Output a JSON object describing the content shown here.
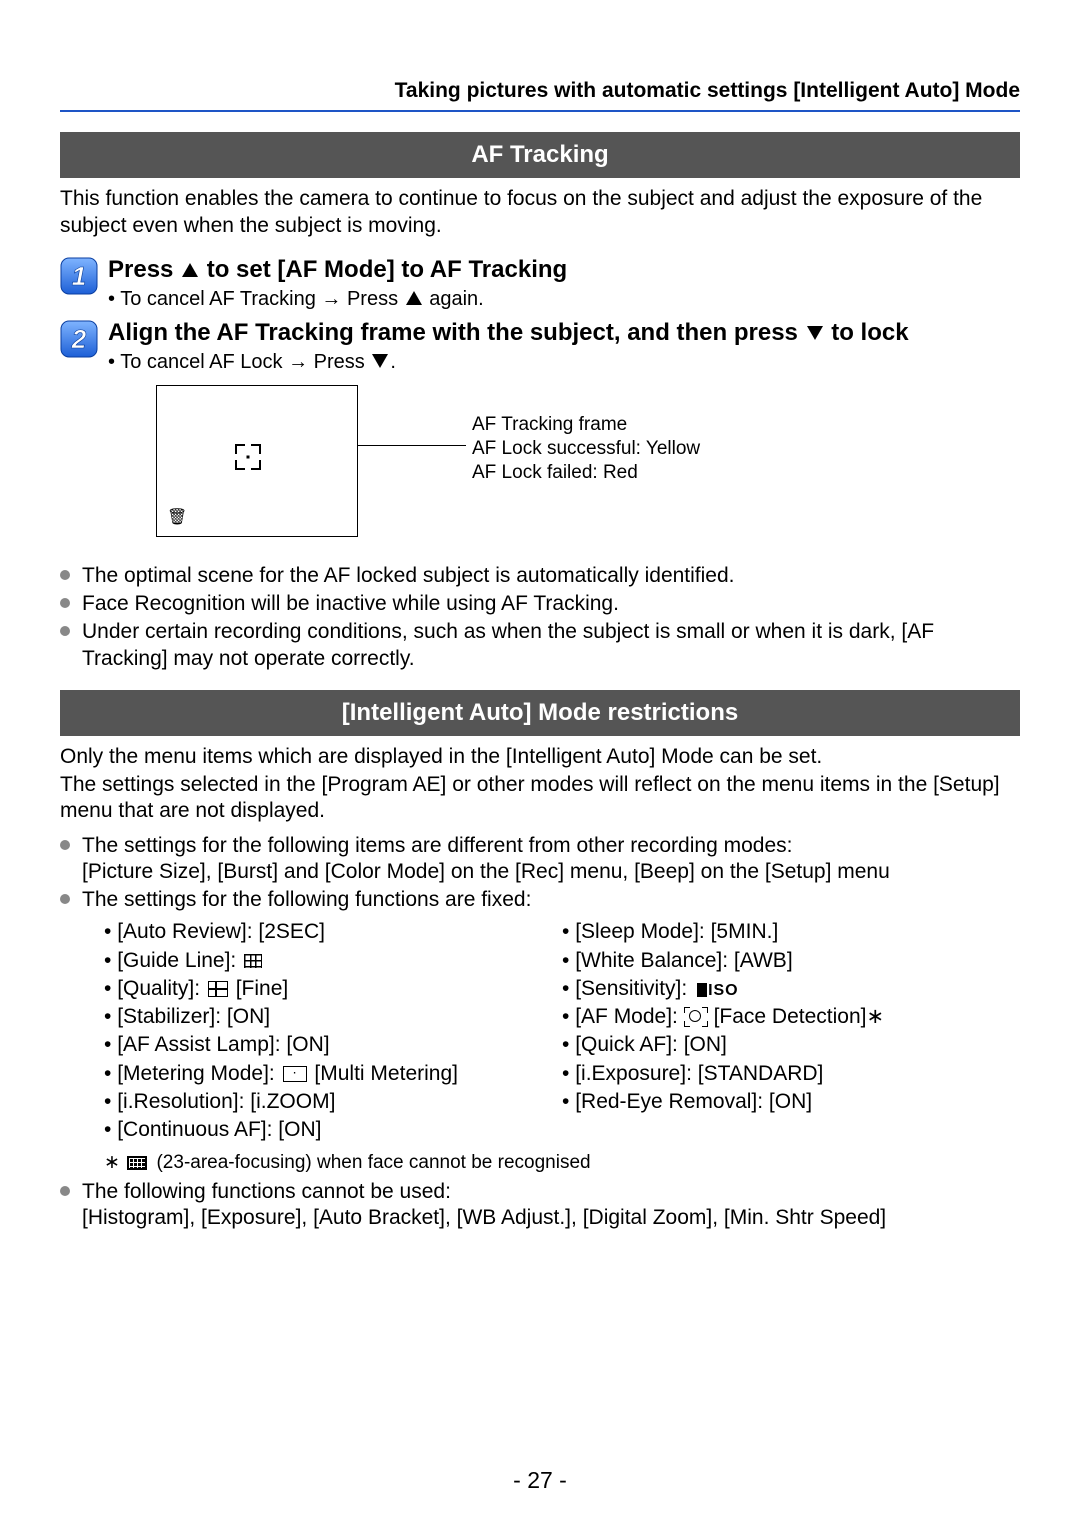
{
  "header": "Taking pictures with automatic settings  [Intelligent Auto] Mode",
  "section1": {
    "title": "AF Tracking",
    "intro": "This function enables the camera to continue to focus on the subject and adjust the exposure of the subject even when the subject is moving.",
    "step1": {
      "title_a": "Press ",
      "title_b": " to set [AF Mode] to AF Tracking",
      "sub_a": "To cancel AF Tracking → Press ",
      "sub_b": " again."
    },
    "step2": {
      "title_a": "Align the AF Tracking frame with the subject, and then press ",
      "title_b": " to lock",
      "sub_a": "To cancel AF Lock → Press ",
      "sub_b": "."
    },
    "diagram": {
      "l1": "AF Tracking frame",
      "l2": "AF Lock successful: Yellow",
      "l3": "AF Lock failed: Red"
    },
    "notes": [
      "The optimal scene for the AF locked subject is automatically identified.",
      "Face Recognition will be inactive while using AF Tracking.",
      "Under certain recording conditions, such as when the subject is small or when it is dark, [AF Tracking] may not operate correctly."
    ]
  },
  "section2": {
    "title": "[Intelligent Auto] Mode restrictions",
    "p1": "Only the menu items which are displayed in the [Intelligent Auto] Mode can be set.",
    "p2": "The settings selected in the [Program AE] or other modes will reflect on the menu items in the [Setup] menu that are not displayed.",
    "b1": "The settings for the following items are different from other recording modes:",
    "b1s": "[Picture Size], [Burst] and [Color Mode] on the [Rec] menu, [Beep] on the [Setup] menu",
    "b2": "The settings for the following functions are fixed:",
    "left": {
      "i0": "[Auto Review]: [2SEC]",
      "i1": "[Guide Line]: ",
      "i2a": "[Quality]: ",
      "i2b": " [Fine]",
      "i3": "[Stabilizer]: [ON]",
      "i4": "[AF Assist Lamp]: [ON]",
      "i5a": "[Metering Mode]: ",
      "i5b": " [Multi Metering]",
      "i6": "[i.Resolution]: [i.ZOOM]",
      "i7": "[Continuous AF]: [ON]"
    },
    "right": {
      "i0": "[Sleep Mode]: [5MIN.]",
      "i1": "[White Balance]: [AWB]",
      "i2": "[Sensitivity]: ",
      "i3a": "[AF Mode]: ",
      "i3b": " [Face Detection]",
      "i4": "[Quick AF]: [ON]",
      "i5": "[i.Exposure]: [STANDARD]",
      "i6": "[Red-Eye Removal]: [ON]"
    },
    "footnote": " (23-area-focusing) when face cannot be recognised",
    "b3": "The following functions cannot be used:",
    "b3s": "[Histogram], [Exposure], [Auto Bracket], [WB Adjust.], [Digital Zoom], [Min. Shtr Speed]"
  },
  "page_number": "- 27 -"
}
